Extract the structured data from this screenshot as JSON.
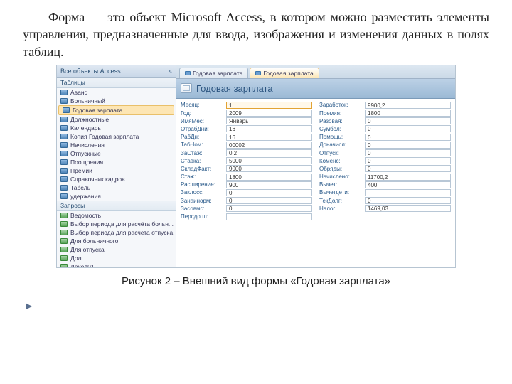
{
  "text": {
    "paragraph": "Форма — это объект Microsoft Access, в котором можно разместить элементы управления, предназначенные для ввода, изображения и изменения данных в полях таблиц.",
    "caption": "Рисунок 2 – Внешний вид формы «Годовая зарплата»"
  },
  "nav": {
    "header": "Все объекты Access",
    "section_tables": "Таблицы",
    "section_queries": "Запросы",
    "tables": [
      "Аванс",
      "Больничный",
      "Годовая зарплата",
      "Должностные",
      "Календарь",
      "Копия Годовая зарплата",
      "Начисления",
      "Отпускные",
      "Поощрения",
      "Премии",
      "Справочник кадров",
      "Табель",
      "удержания"
    ],
    "queries": [
      "Ведомость",
      "Выбор периода для расчёта больн...",
      "Выбор периода для расчета отпуска",
      "Для больничного",
      "Для отпуска",
      "Долг",
      "Доход01"
    ]
  },
  "tab1": "Годовая зарплата",
  "tab2": "Годовая зарплата",
  "form_title": "Годовая зарплата",
  "left_fields": [
    {
      "label": "Месяц:",
      "value": "1"
    },
    {
      "label": "Год:",
      "value": "2009"
    },
    {
      "label": "ИмяМес:",
      "value": "Январь"
    },
    {
      "label": "ОтрабДни:",
      "value": "16"
    },
    {
      "label": "РабДн:",
      "value": "16"
    },
    {
      "label": "ТабНом:",
      "value": "00002"
    },
    {
      "label": "ЗаСтаж:",
      "value": "0,2"
    },
    {
      "label": "Ставка:",
      "value": "5000"
    },
    {
      "label": "СкладФакт:",
      "value": "9000"
    },
    {
      "label": "Стаж:",
      "value": "1800"
    },
    {
      "label": "Расширение:",
      "value": "900"
    },
    {
      "label": "Заклосс:",
      "value": "0"
    },
    {
      "label": "Занаинорм:",
      "value": "0"
    },
    {
      "label": "Засовмс:",
      "value": "0"
    },
    {
      "label": "Персдопл:",
      "value": ""
    }
  ],
  "right_fields": [
    {
      "label": "Заработок:",
      "value": "9900,2"
    },
    {
      "label": "Премия:",
      "value": "1800"
    },
    {
      "label": "Разовая:",
      "value": "0"
    },
    {
      "label": "Сумбол:",
      "value": "0"
    },
    {
      "label": "Помощь:",
      "value": "0"
    },
    {
      "label": "Доначисл:",
      "value": "0"
    },
    {
      "label": "Отпуск:",
      "value": "0"
    },
    {
      "label": "Коменс:",
      "value": "0"
    },
    {
      "label": "Обряды:",
      "value": "0"
    },
    {
      "label": "Начислено:",
      "value": "11700,2"
    },
    {
      "label": "Вычет:",
      "value": "400"
    },
    {
      "label": "Вычетдети:",
      "value": ""
    },
    {
      "label": "ТекДолг:",
      "value": "0"
    },
    {
      "label": "Налог:",
      "value": "1469,03"
    }
  ]
}
